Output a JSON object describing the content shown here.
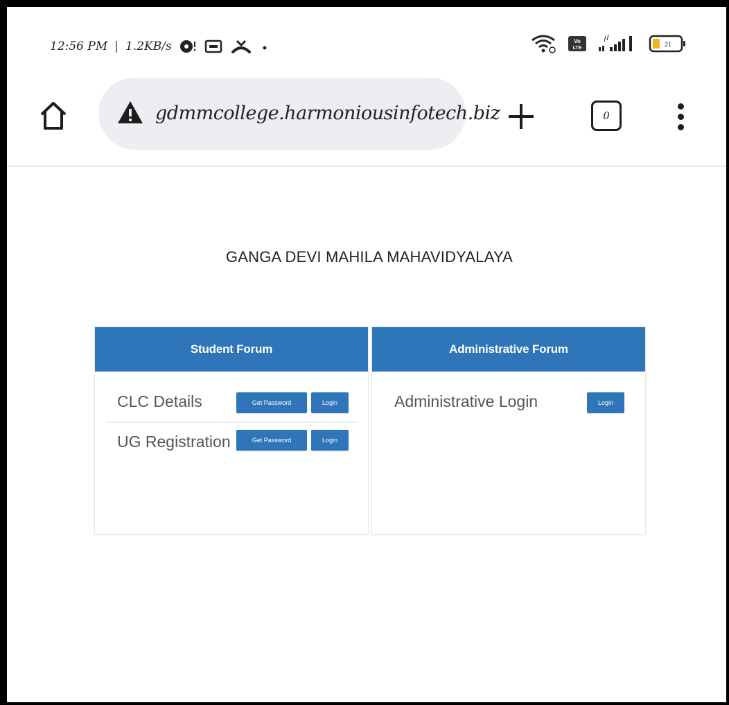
{
  "status_bar": {
    "time": "12:56 PM",
    "speed": "1.2KB/s",
    "separator": "|",
    "network_label": "Vo LTE",
    "battery_level": "21"
  },
  "browser": {
    "url": "gdmmcollege.harmoniousinfotech.biz",
    "tab_count": "0"
  },
  "page": {
    "title": "GANGA DEVI MAHILA MAHAVIDYALAYA",
    "student_forum": {
      "heading": "Student Forum",
      "rows": [
        {
          "label": "CLC Details",
          "get_password": "Get Password",
          "login": "Login"
        },
        {
          "label": "UG Registration",
          "get_password": "Get Password",
          "login": "Login"
        }
      ]
    },
    "admin_forum": {
      "heading": "Administrative Forum",
      "rows": [
        {
          "label": "Administrative Login",
          "login": "Login"
        }
      ]
    }
  },
  "colors": {
    "accent": "#2e75b9",
    "urlbar_bg": "#eceef1"
  },
  "icons": [
    "home-icon",
    "security-warning-icon",
    "plus-icon",
    "tabs-icon",
    "more-menu-icon",
    "wifi-icon",
    "signal-icon",
    "battery-icon"
  ]
}
